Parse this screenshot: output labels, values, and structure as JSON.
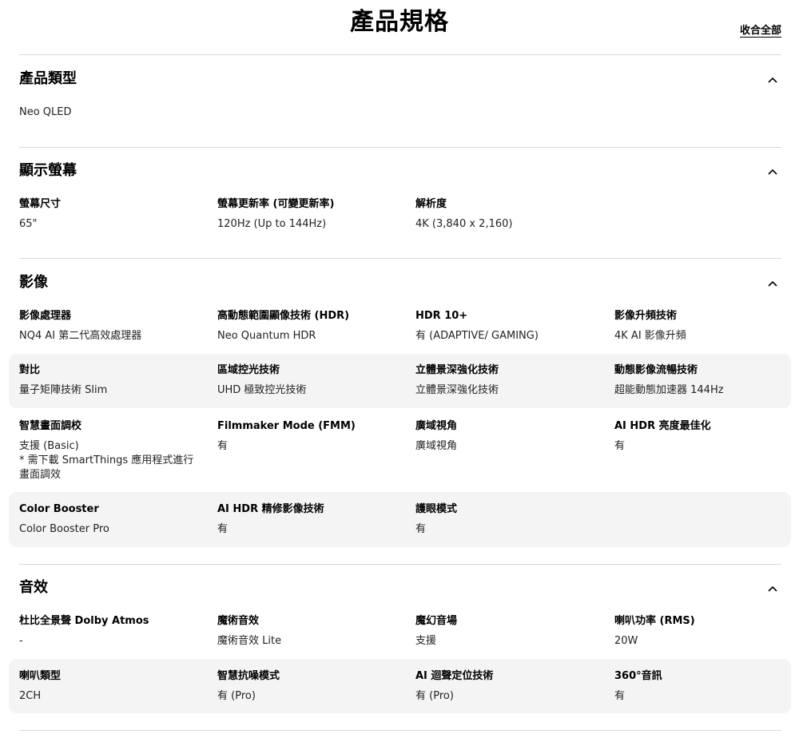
{
  "header": {
    "title": "產品規格",
    "collapse_all_label": "收合全部"
  },
  "sections": {
    "product_type": {
      "title": "產品類型",
      "value": "Neo QLED"
    },
    "display": {
      "title": "顯示螢幕",
      "specs": [
        {
          "label": "螢幕尺寸",
          "value": "65\""
        },
        {
          "label": "螢幕更新率 (可變更新率)",
          "value": "120Hz (Up to 144Hz)"
        },
        {
          "label": "解析度",
          "value": "4K (3,840 x 2,160)"
        }
      ]
    },
    "video": {
      "title": "影像",
      "specs": [
        {
          "label": "影像處理器",
          "value": "NQ4 AI 第二代高效處理器"
        },
        {
          "label": "高動態範圍顯像技術 (HDR)",
          "value": "Neo Quantum HDR"
        },
        {
          "label": "HDR 10+",
          "value": "有 (ADAPTIVE/ GAMING)"
        },
        {
          "label": "影像升頻技術",
          "value": "4K AI 影像升頻"
        },
        {
          "label": "對比",
          "value": "量子矩陣技術 Slim"
        },
        {
          "label": "區域控光技術",
          "value": "UHD 極致控光技術"
        },
        {
          "label": "立體景深強化技術",
          "value": "立體景深強化技術"
        },
        {
          "label": "動態影像流暢技術",
          "value": "超能動態加速器 144Hz"
        },
        {
          "label": "智慧畫面調校",
          "value_lines": [
            "支援 (Basic)",
            "* 需下載 SmartThings 應用程式進行",
            "畫面調效"
          ]
        },
        {
          "label": "Filmmaker Mode (FMM)",
          "value": "有"
        },
        {
          "label": "廣域視角",
          "value": "廣域視角"
        },
        {
          "label": "AI HDR 亮度最佳化",
          "value": "有"
        },
        {
          "label": "Color Booster",
          "value": "Color Booster Pro"
        },
        {
          "label": "AI HDR 精修影像技術",
          "value": "有"
        },
        {
          "label": "護眼模式",
          "value": "有"
        }
      ]
    },
    "audio": {
      "title": "音效",
      "specs": [
        {
          "label": "杜比全景聲 Dolby Atmos",
          "value": "-"
        },
        {
          "label": "魔術音效",
          "value": "魔術音效 Lite"
        },
        {
          "label": "魔幻音場",
          "value": "支援"
        },
        {
          "label": "喇叭功率 (RMS)",
          "value": "20W"
        },
        {
          "label": "喇叭類型",
          "value": "2CH"
        },
        {
          "label": "智慧抗噪模式",
          "value": "有 (Pro)"
        },
        {
          "label": "AI 迴聲定位技術",
          "value": "有 (Pro)"
        },
        {
          "label": "360°音訊",
          "value": "有"
        }
      ]
    }
  }
}
